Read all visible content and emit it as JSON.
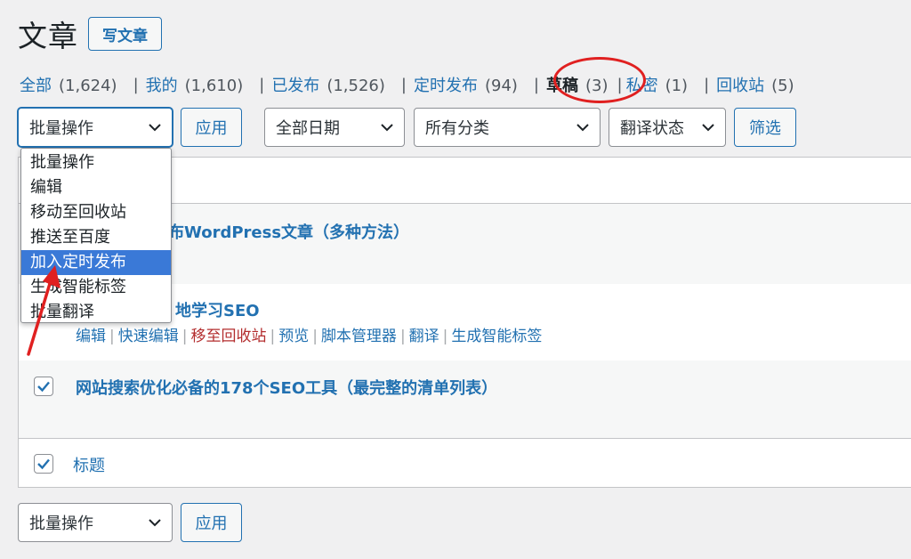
{
  "header": {
    "title": "文章",
    "add_new": "写文章"
  },
  "filters": [
    {
      "label": "全部",
      "count": "(1,624)",
      "current": false
    },
    {
      "label": "我的",
      "count": "(1,610)",
      "current": false
    },
    {
      "label": "已发布",
      "count": "(1,526)",
      "current": false
    },
    {
      "label": "定时发布",
      "count": "(94)",
      "current": false
    },
    {
      "label": "草稿",
      "count": "(3)",
      "current": true
    },
    {
      "label": "私密",
      "count": "(1)",
      "current": false
    },
    {
      "label": "回收站",
      "count": "(5)",
      "current": false
    }
  ],
  "toolbar": {
    "bulk_select": "批量操作",
    "apply": "应用",
    "date_select": "全部日期",
    "category_select": "所有分类",
    "translate_select": "翻译状态",
    "filter": "筛选"
  },
  "bulk_dropdown": {
    "options": [
      "批量操作",
      "编辑",
      "移动至回收站",
      "推送至百度",
      "加入定时发布",
      "生成智能标签",
      "批量翻译"
    ],
    "highlighted": "加入定时发布"
  },
  "posts": [
    {
      "title_visible": "布WordPress文章（多种方法）"
    },
    {
      "title_visible": "地学习SEO",
      "actions": [
        "编辑",
        "快速编辑",
        "移至回收站",
        "预览",
        "脚本管理器",
        "翻译",
        "生成智能标签"
      ]
    },
    {
      "title": "网站搜索优化必备的178个SEO工具（最完整的清单列表）"
    }
  ],
  "table_footer": {
    "column_label": "标题"
  },
  "bottom_toolbar": {
    "bulk_select": "批量操作",
    "apply": "应用"
  },
  "colors": {
    "accent": "#2271b1",
    "trash": "#b32d2e",
    "annotation": "#e02020",
    "dropdown_highlight": "#3a79d7"
  }
}
